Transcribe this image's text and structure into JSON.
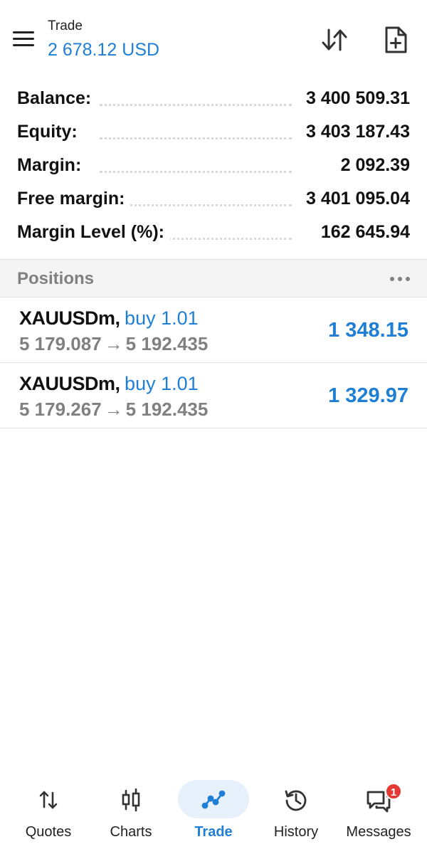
{
  "header": {
    "title": "Trade",
    "balance_display": "2 678.12 USD"
  },
  "account": {
    "rows": [
      {
        "label": "Balance:",
        "value": "3 400 509.31"
      },
      {
        "label": "Equity:",
        "value": "3 403 187.43"
      },
      {
        "label": "Margin:",
        "value": "2 092.39"
      },
      {
        "label": "Free margin:",
        "value": "3 401 095.04"
      },
      {
        "label": "Margin Level (%):",
        "value": "162 645.94"
      }
    ]
  },
  "positions": {
    "title": "Positions",
    "items": [
      {
        "symbol": "XAUUSDm",
        "comma": ",",
        "side": "buy 1.01",
        "open_price": "5 179.087",
        "arrow": "→",
        "current_price": "5 192.435",
        "profit": "1 348.15"
      },
      {
        "symbol": "XAUUSDm",
        "comma": ",",
        "side": "buy 1.01",
        "open_price": "5 179.267",
        "arrow": "→",
        "current_price": "5 192.435",
        "profit": "1 329.97"
      }
    ]
  },
  "nav": {
    "items": [
      {
        "label": "Quotes",
        "icon": "quotes-icon"
      },
      {
        "label": "Charts",
        "icon": "charts-icon"
      },
      {
        "label": "Trade",
        "icon": "trade-icon",
        "active": true
      },
      {
        "label": "History",
        "icon": "history-icon"
      },
      {
        "label": "Messages",
        "icon": "messages-icon",
        "badge": "1"
      }
    ]
  },
  "colors": {
    "accent": "#1f7fd4",
    "muted": "#808080",
    "badge": "#e53935",
    "active_pill": "#e7f1fb"
  }
}
